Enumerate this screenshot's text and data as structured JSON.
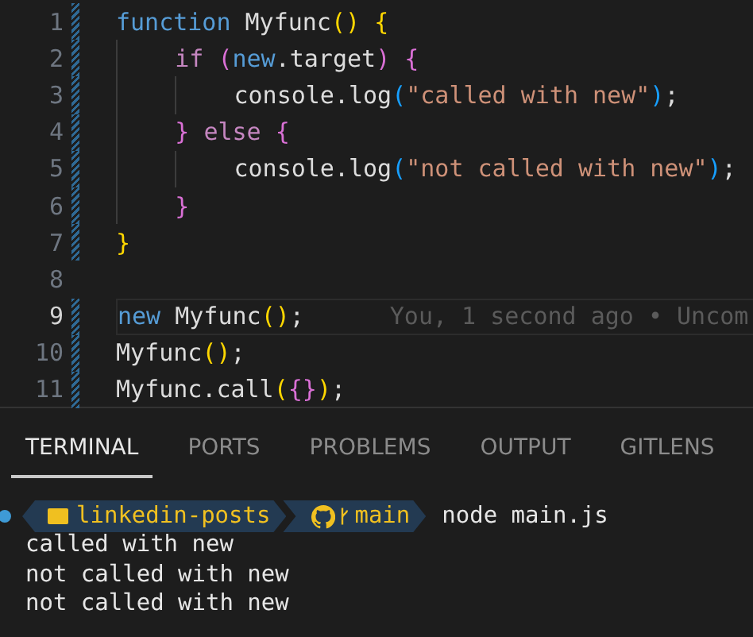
{
  "editor": {
    "lines": [
      {
        "number": "1",
        "changed": true,
        "active": false,
        "tokens": [
          {
            "kind": "keyword",
            "text": "function"
          },
          {
            "kind": "text",
            "text": " Myfunc"
          },
          {
            "kind": "bracket1",
            "text": "()"
          },
          {
            "kind": "bracket1",
            "text": " {"
          }
        ]
      },
      {
        "number": "2",
        "changed": true,
        "active": false,
        "tokens": [
          {
            "kind": "control",
            "text": "    if"
          },
          {
            "kind": "bracket2",
            "text": " ("
          },
          {
            "kind": "keyword",
            "text": "new"
          },
          {
            "kind": "text",
            "text": ".target"
          },
          {
            "kind": "bracket2",
            "text": ")"
          },
          {
            "kind": "bracket2",
            "text": " {"
          }
        ]
      },
      {
        "number": "3",
        "changed": true,
        "active": false,
        "tokens": [
          {
            "kind": "text",
            "text": "        console.log"
          },
          {
            "kind": "bracket3",
            "text": "("
          },
          {
            "kind": "string",
            "text": "\"called with new\""
          },
          {
            "kind": "bracket3",
            "text": ")"
          },
          {
            "kind": "text",
            "text": ";"
          }
        ]
      },
      {
        "number": "4",
        "changed": true,
        "active": false,
        "tokens": [
          {
            "kind": "bracket2",
            "text": "    }"
          },
          {
            "kind": "control",
            "text": " else"
          },
          {
            "kind": "bracket2",
            "text": " {"
          }
        ]
      },
      {
        "number": "5",
        "changed": true,
        "active": false,
        "tokens": [
          {
            "kind": "text",
            "text": "        console.log"
          },
          {
            "kind": "bracket3",
            "text": "("
          },
          {
            "kind": "string",
            "text": "\"not called with new\""
          },
          {
            "kind": "bracket3",
            "text": ")"
          },
          {
            "kind": "text",
            "text": ";"
          }
        ]
      },
      {
        "number": "6",
        "changed": true,
        "active": false,
        "tokens": [
          {
            "kind": "bracket2",
            "text": "    }"
          }
        ]
      },
      {
        "number": "7",
        "changed": true,
        "active": false,
        "tokens": [
          {
            "kind": "bracket1",
            "text": "}"
          }
        ]
      },
      {
        "number": "8",
        "changed": false,
        "active": false
      },
      {
        "number": "9",
        "changed": true,
        "active": true,
        "blame": "You, 1 second ago • Uncom",
        "tokens": [
          {
            "kind": "keyword",
            "text": "new"
          },
          {
            "kind": "text",
            "text": " Myfunc"
          },
          {
            "kind": "bracket1",
            "text": "()"
          },
          {
            "kind": "text",
            "text": ";"
          }
        ]
      },
      {
        "number": "10",
        "changed": true,
        "active": false,
        "tokens": [
          {
            "kind": "text",
            "text": "Myfunc"
          },
          {
            "kind": "bracket1",
            "text": "()"
          },
          {
            "kind": "text",
            "text": ";"
          }
        ]
      },
      {
        "number": "11",
        "changed": true,
        "active": false,
        "tokens": [
          {
            "kind": "text",
            "text": "Myfunc.call"
          },
          {
            "kind": "bracket1",
            "text": "("
          },
          {
            "kind": "bracket2",
            "text": "{}"
          },
          {
            "kind": "bracket1",
            "text": ")"
          },
          {
            "kind": "text",
            "text": ";"
          }
        ]
      }
    ]
  },
  "panel": {
    "tabs": [
      {
        "label": "TERMINAL",
        "selected": true
      },
      {
        "label": "PORTS",
        "selected": false
      },
      {
        "label": "PROBLEMS",
        "selected": false
      },
      {
        "label": "OUTPUT",
        "selected": false
      },
      {
        "label": "GITLENS",
        "selected": false
      }
    ],
    "terminal": {
      "prompt": {
        "folder": "linkedin-posts",
        "branch": "main",
        "command": "node main.js"
      },
      "output": [
        "called with new",
        "not called with new",
        "not called with new"
      ]
    }
  }
}
